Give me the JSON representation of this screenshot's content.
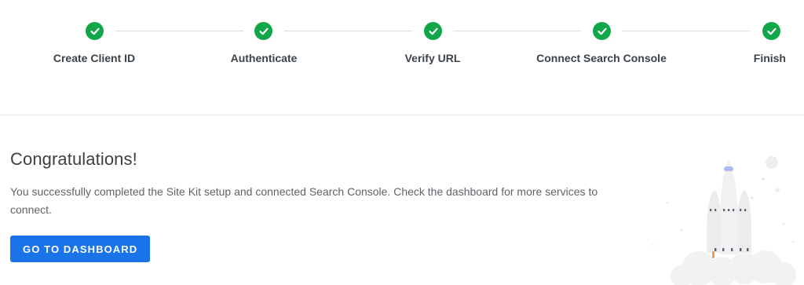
{
  "stepper": {
    "steps": [
      {
        "label": "Create Client ID",
        "status": "complete"
      },
      {
        "label": "Authenticate",
        "status": "complete"
      },
      {
        "label": "Verify URL",
        "status": "complete"
      },
      {
        "label": "Connect Search Console",
        "status": "complete"
      },
      {
        "label": "Finish",
        "status": "complete"
      }
    ],
    "complete_color": "#10a64a"
  },
  "main": {
    "title": "Congratulations!",
    "description": "You successfully completed the Site Kit setup and connected Search Console. Check the dashboard for more services to connect.",
    "button_label": "GO TO DASHBOARD"
  },
  "colors": {
    "accent": "#1a73e8",
    "success": "#10a64a"
  },
  "icons": {
    "step_complete": "checkmark-icon",
    "illustration": "rocket-launch-illustration"
  }
}
